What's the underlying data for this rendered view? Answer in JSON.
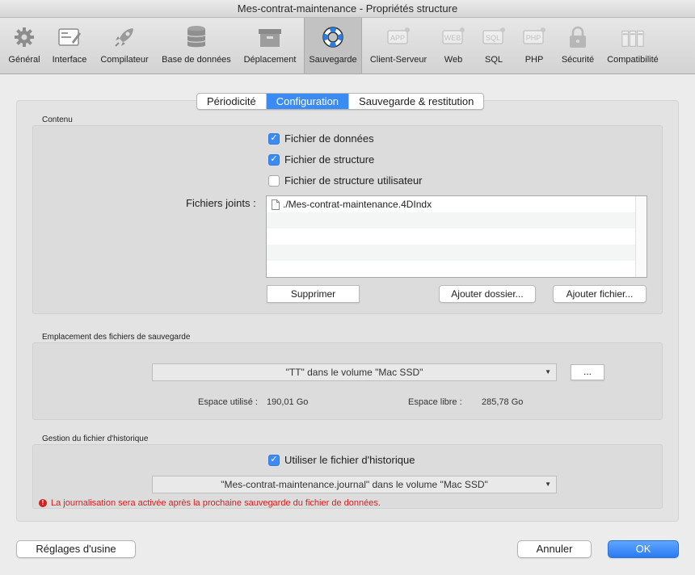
{
  "window": {
    "title": "Mes-contrat-maintenance - Propriétés structure"
  },
  "toolbar": {
    "items": [
      {
        "label": "Général",
        "icon": "gear-icon",
        "active": false
      },
      {
        "label": "Interface",
        "icon": "interface-icon",
        "active": false
      },
      {
        "label": "Compilateur",
        "icon": "rocket-icon",
        "active": false
      },
      {
        "label": "Base de données",
        "icon": "database-icon",
        "active": false
      },
      {
        "label": "Déplacement",
        "icon": "box-icon",
        "active": false
      },
      {
        "label": "Sauvegarde",
        "icon": "lifebuoy-icon",
        "active": true
      },
      {
        "label": "Client-Serveur",
        "icon": "app-server-icon",
        "badge": "APP",
        "active": false
      },
      {
        "label": "Web",
        "icon": "web-server-icon",
        "badge": "WEB",
        "active": false
      },
      {
        "label": "SQL",
        "icon": "sql-server-icon",
        "badge": "SQL",
        "active": false
      },
      {
        "label": "PHP",
        "icon": "php-server-icon",
        "badge": "PHP",
        "active": false
      },
      {
        "label": "Sécurité",
        "icon": "lock-icon",
        "active": false
      },
      {
        "label": "Compatibilité",
        "icon": "compatibility-icon",
        "active": false
      }
    ]
  },
  "tabs": [
    {
      "label": "Périodicité",
      "selected": false
    },
    {
      "label": "Configuration",
      "selected": true
    },
    {
      "label": "Sauvegarde & restitution",
      "selected": false
    }
  ],
  "contenu": {
    "title": "Contenu",
    "checkboxes": [
      {
        "label": "Fichier de données",
        "checked": true
      },
      {
        "label": "Fichier de structure",
        "checked": true
      },
      {
        "label": "Fichier de structure utilisateur",
        "checked": false
      }
    ],
    "attached_label": "Fichiers joints :",
    "files": [
      "./Mes-contrat-maintenance.4DIndx"
    ],
    "buttons": {
      "remove": "Supprimer",
      "add_folder": "Ajouter dossier...",
      "add_file": "Ajouter fichier..."
    }
  },
  "emplacement": {
    "title": "Emplacement des fichiers de sauvegarde",
    "volume": "\"TT\" dans le volume \"Mac SSD\"",
    "browse": "...",
    "used_label": "Espace utilisé :",
    "used_value": "190,01 Go",
    "free_label": "Espace libre :",
    "free_value": "285,78 Go"
  },
  "historique": {
    "title": "Gestion du fichier d'historique",
    "use_label": "Utiliser le fichier d'historique",
    "use_checked": true,
    "journal": "\"Mes-contrat-maintenance.journal\" dans le volume \"Mac SSD\"",
    "warning": "La journalisation sera activée après la prochaine sauvegarde du fichier de données."
  },
  "footer": {
    "factory": "Réglages d'usine",
    "cancel": "Annuler",
    "ok": "OK"
  },
  "colors": {
    "accent": "#3b8bf5",
    "warning": "#d62020"
  }
}
